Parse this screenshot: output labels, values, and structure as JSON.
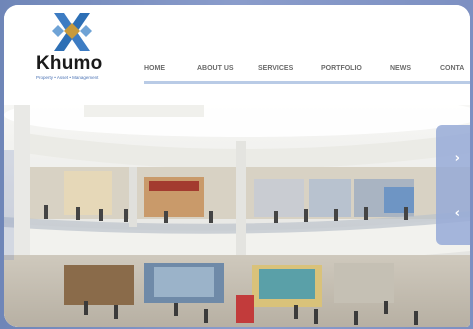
{
  "brand": {
    "name": "Khumo",
    "tagline": "Property • Asset • Management",
    "mark_colors": {
      "left": "#2d6fb5",
      "right": "#3d7cc3",
      "center": "#c79a3c"
    }
  },
  "nav": {
    "items": [
      {
        "label": "HOME"
      },
      {
        "label": "ABOUT US"
      },
      {
        "label": "SERVICES"
      },
      {
        "label": "PORTFOLIO"
      },
      {
        "label": "NEWS"
      },
      {
        "label": "CONTA"
      }
    ]
  },
  "hero": {
    "image_description_icon": "mall-interior-photo"
  },
  "slider": {
    "next_icon": "chevron-right-icon",
    "prev_icon": "chevron-left-icon",
    "next_glyph": "›",
    "prev_glyph": "‹"
  },
  "colors": {
    "accent": "#b9cbe6",
    "nav_text": "#6b6b6b",
    "frame": "#7d90c2"
  }
}
